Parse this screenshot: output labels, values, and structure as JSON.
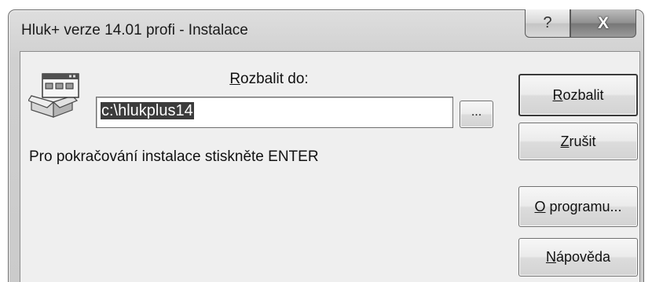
{
  "window": {
    "title": "Hluk+ verze 14.01 profi - Instalace"
  },
  "caption_buttons": {
    "help": "?",
    "close": "X"
  },
  "extract_to": {
    "label_accel": "R",
    "label_rest": "ozbalit do:",
    "path": "c:\\hlukplus14",
    "browse": "..."
  },
  "message": "Pro pokračování instalace stiskněte ENTER",
  "buttons": [
    {
      "accel": "R",
      "rest": "ozbalit"
    },
    {
      "accel": "Z",
      "rest": "rušit"
    },
    {
      "accel": "O",
      "rest": " programu..."
    },
    {
      "accel": "N",
      "rest": "ápověda"
    }
  ],
  "icons": {
    "installer": "installer-package-icon",
    "help": "help-icon",
    "close": "close-icon"
  },
  "colors": {
    "selection": "#3c3c3c",
    "client_bg": "#efefef"
  }
}
